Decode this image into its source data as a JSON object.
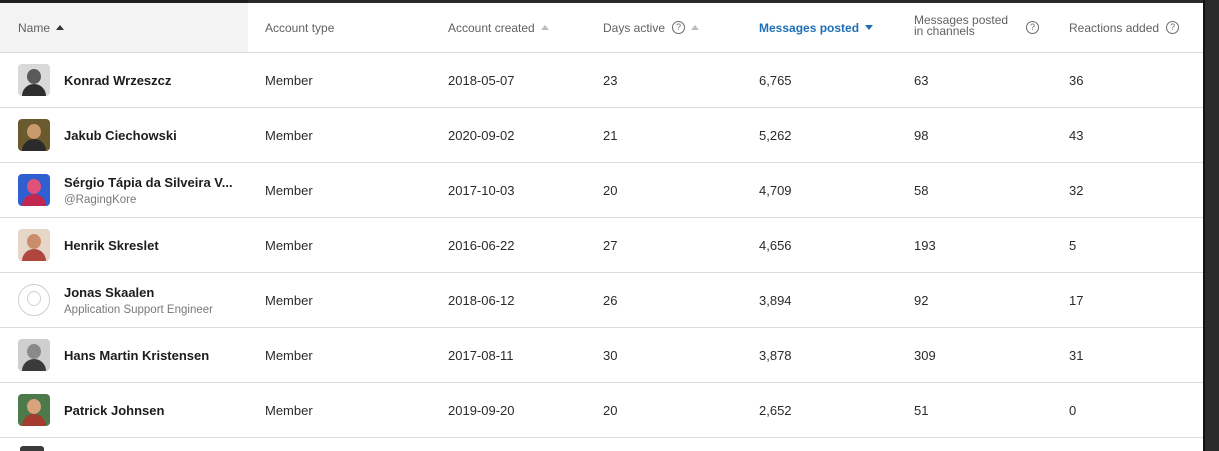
{
  "columns": {
    "name": "Name",
    "account_type": "Account type",
    "account_created": "Account created",
    "days_active": "Days active",
    "messages_posted": "Messages posted",
    "messages_channels_1": "Messages posted",
    "messages_channels_2": "in channels",
    "reactions_added": "Reactions added",
    "help_glyph": "?"
  },
  "rows": [
    {
      "name": "Konrad Wrzeszcz",
      "sub": "",
      "type": "Member",
      "created": "2018-05-07",
      "days": "23",
      "messages": "6,765",
      "channels": "63",
      "reactions": "36"
    },
    {
      "name": "Jakub Ciechowski",
      "sub": "",
      "type": "Member",
      "created": "2020-09-02",
      "days": "21",
      "messages": "5,262",
      "channels": "98",
      "reactions": "43"
    },
    {
      "name": "Sérgio Tápia da Silveira V...",
      "sub": "@RagingKore",
      "type": "Member",
      "created": "2017-10-03",
      "days": "20",
      "messages": "4,709",
      "channels": "58",
      "reactions": "32"
    },
    {
      "name": "Henrik Skreslet",
      "sub": "",
      "type": "Member",
      "created": "2016-06-22",
      "days": "27",
      "messages": "4,656",
      "channels": "193",
      "reactions": "5"
    },
    {
      "name": "Jonas Skaalen",
      "sub": "Application Support Engineer",
      "type": "Member",
      "created": "2018-06-12",
      "days": "26",
      "messages": "3,894",
      "channels": "92",
      "reactions": "17"
    },
    {
      "name": "Hans Martin Kristensen",
      "sub": "",
      "type": "Member",
      "created": "2017-08-11",
      "days": "30",
      "messages": "3,878",
      "channels": "309",
      "reactions": "31"
    },
    {
      "name": "Patrick Johnsen",
      "sub": "",
      "type": "Member",
      "created": "2019-09-20",
      "days": "20",
      "messages": "2,652",
      "channels": "51",
      "reactions": "0"
    }
  ],
  "colors": {
    "active_header": "#1d6fb8",
    "text": "#2b2b2b",
    "muted": "#616161",
    "divider": "#dcdcdc"
  }
}
